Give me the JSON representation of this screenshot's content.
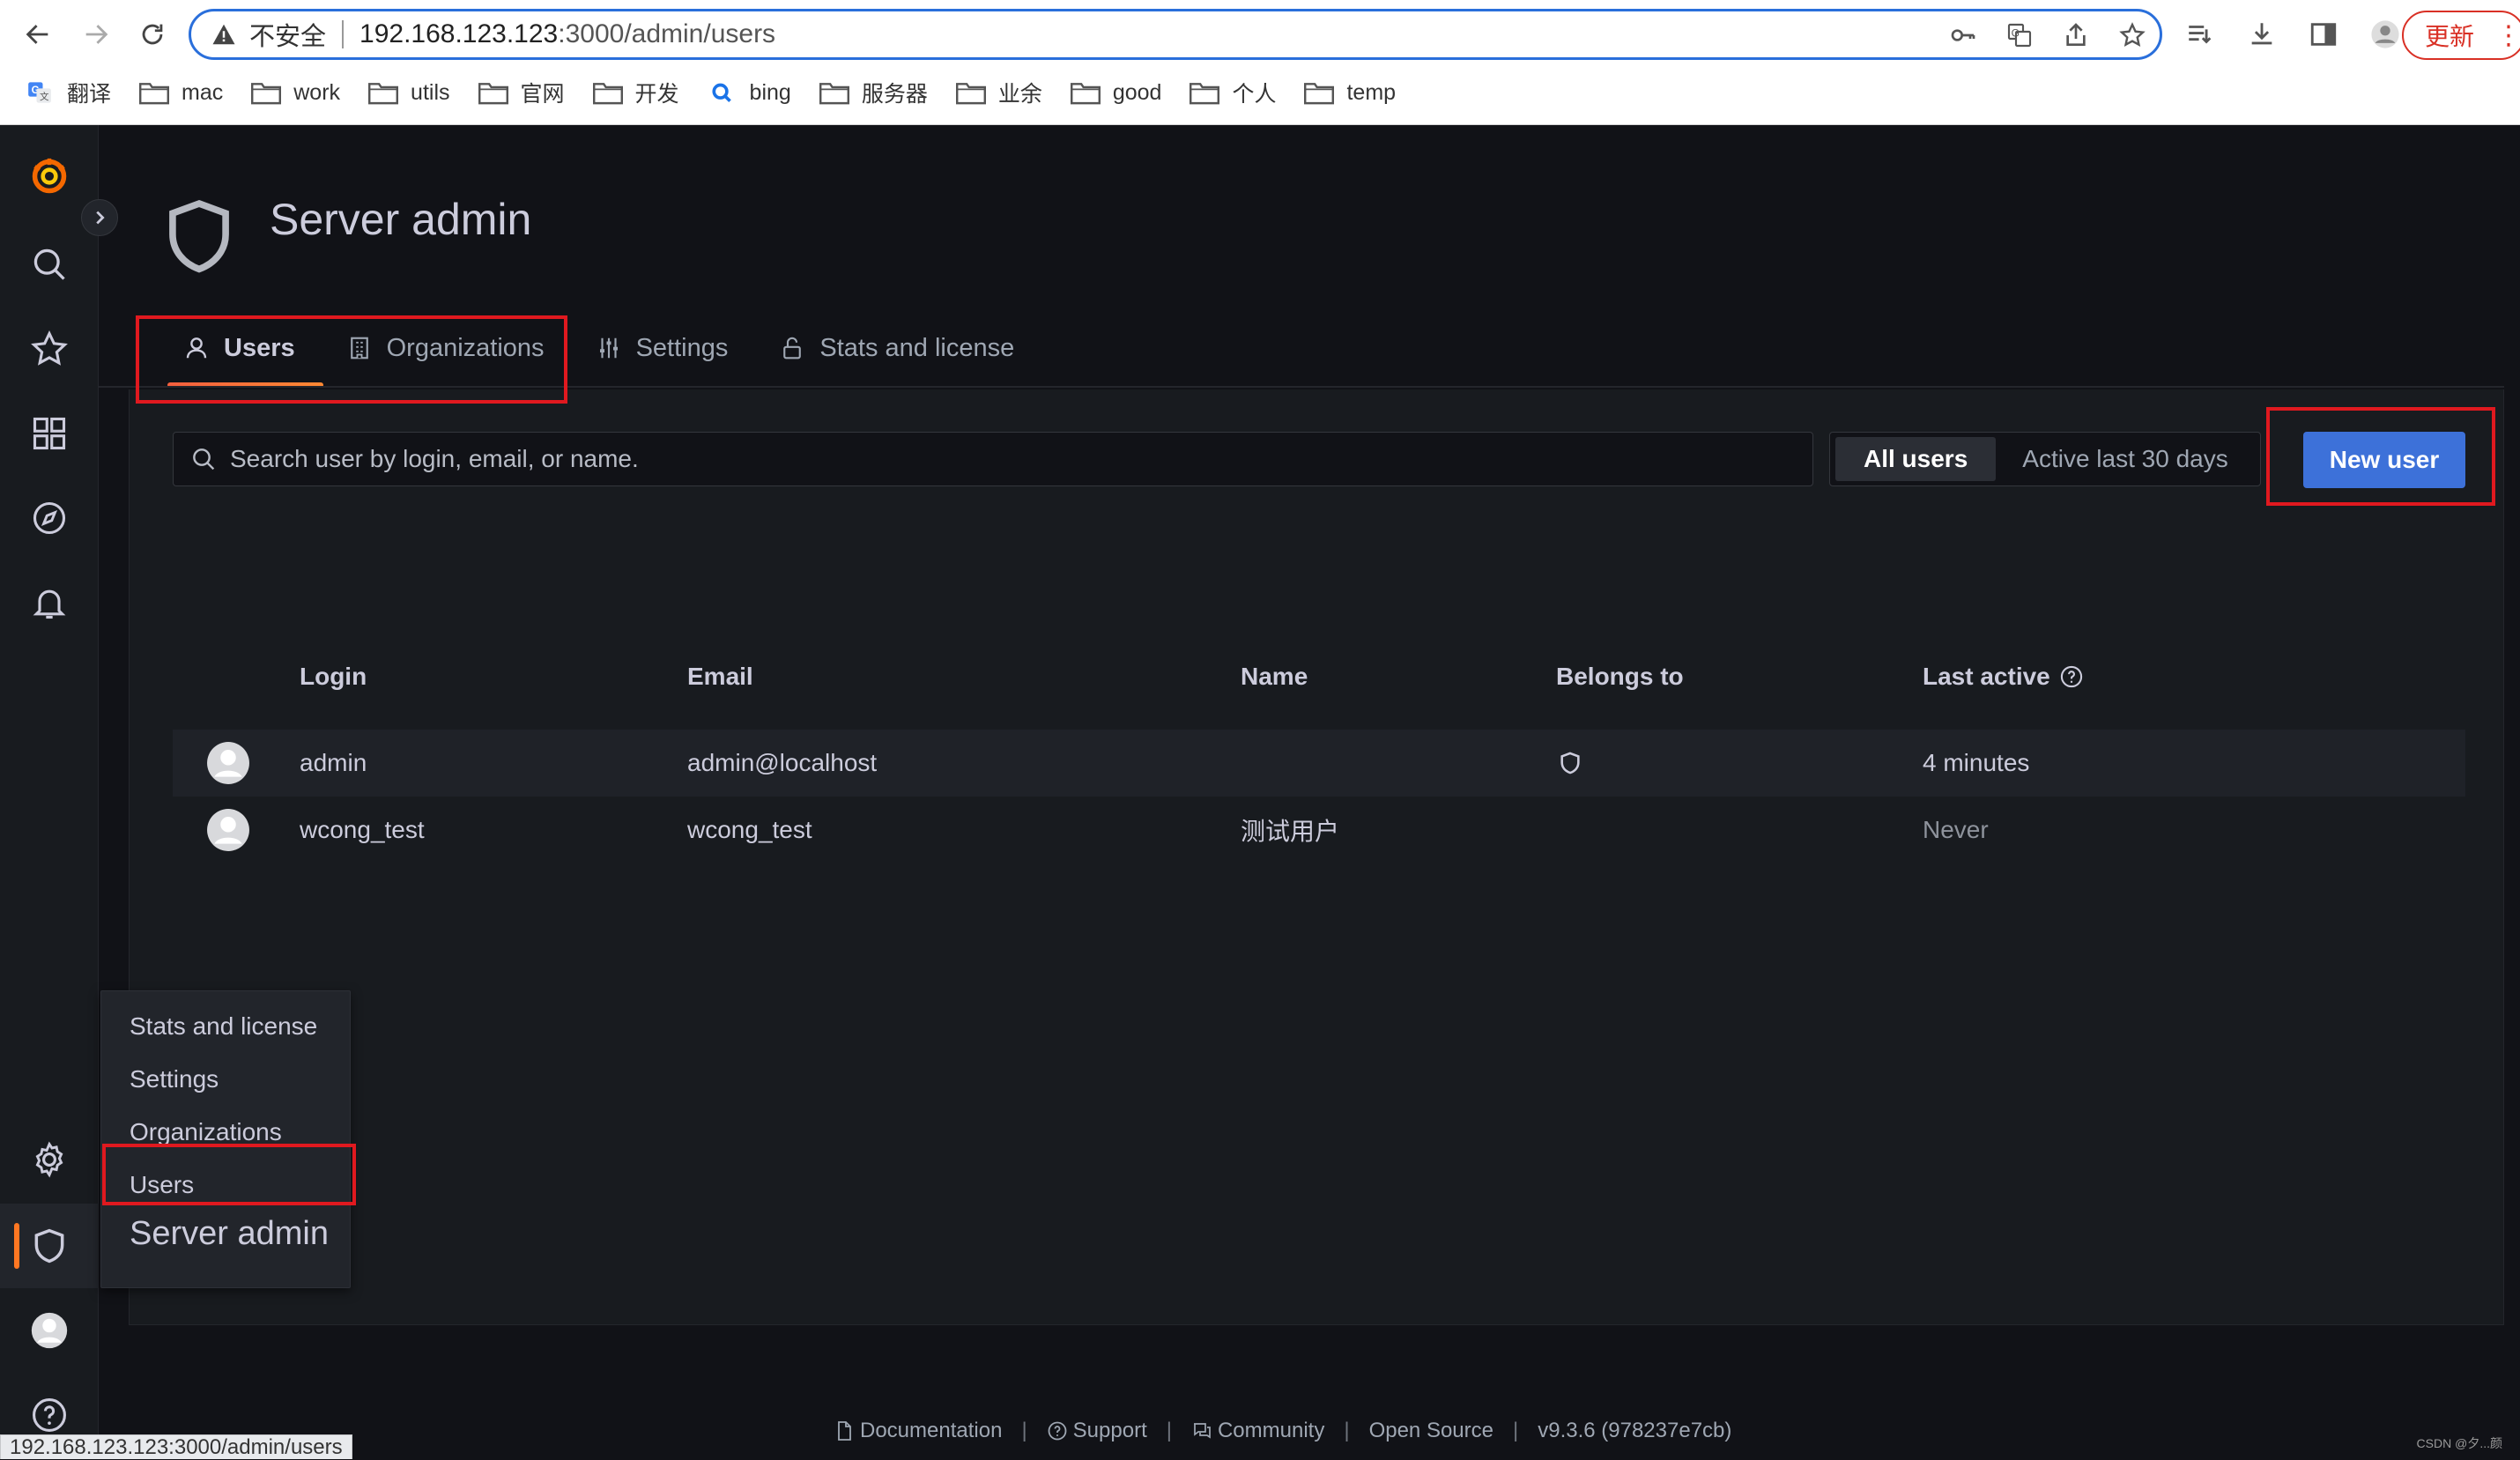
{
  "browser": {
    "insecure_label": "不安全",
    "url_host": "192.168.123.123",
    "url_path": ":3000/admin/users",
    "update_label": "更新",
    "bookmarks": [
      {
        "label": "翻译",
        "icon": "translate-icon"
      },
      {
        "label": "mac",
        "icon": "folder-icon"
      },
      {
        "label": "work",
        "icon": "folder-icon"
      },
      {
        "label": "utils",
        "icon": "folder-icon"
      },
      {
        "label": "官网",
        "icon": "folder-icon"
      },
      {
        "label": "开发",
        "icon": "folder-icon"
      },
      {
        "label": "bing",
        "icon": "search-icon"
      },
      {
        "label": "服务器",
        "icon": "folder-icon"
      },
      {
        "label": "业余",
        "icon": "folder-icon"
      },
      {
        "label": "good",
        "icon": "folder-icon"
      },
      {
        "label": "个人",
        "icon": "folder-icon"
      },
      {
        "label": "temp",
        "icon": "folder-icon"
      }
    ],
    "status_url": "192.168.123.123:3000/admin/users"
  },
  "page": {
    "title": "Server admin",
    "tabs": [
      {
        "label": "Users",
        "icon": "user-icon",
        "active": true
      },
      {
        "label": "Organizations",
        "icon": "building-icon",
        "active": false
      },
      {
        "label": "Settings",
        "icon": "sliders-icon",
        "active": false
      },
      {
        "label": "Stats and license",
        "icon": "lock-icon",
        "active": false
      }
    ]
  },
  "toolbar": {
    "search_placeholder": "Search user by login, email, or name.",
    "filters": [
      "All users",
      "Active last 30 days"
    ],
    "active_filter": "All users",
    "new_user_label": "New user"
  },
  "table": {
    "headers": [
      "Login",
      "Email",
      "Name",
      "Belongs to",
      "Last active"
    ],
    "rows": [
      {
        "login": "admin",
        "email": "admin@localhost",
        "name": "",
        "belongs_to_icon": "shield-icon",
        "last_active": "4 minutes"
      },
      {
        "login": "wcong_test",
        "email": "wcong_test",
        "name": "测试用户",
        "belongs_to_icon": "",
        "last_active": "Never"
      }
    ]
  },
  "flyout": {
    "items": [
      "Stats and license",
      "Settings",
      "Organizations",
      "Users"
    ],
    "title": "Server admin"
  },
  "footer": {
    "items": [
      {
        "label": "Documentation",
        "icon": "document-icon"
      },
      {
        "label": "Support",
        "icon": "question-icon"
      },
      {
        "label": "Community",
        "icon": "comments-icon"
      },
      {
        "label": "Open Source",
        "icon": ""
      },
      {
        "label": "v9.3.6 (978237e7cb)",
        "icon": ""
      }
    ]
  },
  "watermark": "CSDN @夕...颜",
  "colors": {
    "accent_blue": "#3d71d9",
    "annotation_red": "#e0191f",
    "tab_underline": "#ff7722",
    "background": "#111217"
  }
}
